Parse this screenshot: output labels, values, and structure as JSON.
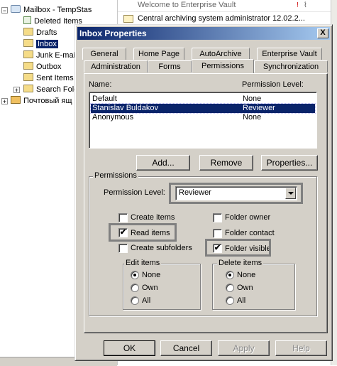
{
  "background": {
    "tree": {
      "mailbox": "Mailbox - TempStas",
      "items": [
        "Deleted Items",
        "Drafts",
        "Inbox",
        "Junk E-mail",
        "Outbox",
        "Sent Items",
        "Search Folders"
      ],
      "selected": "Inbox",
      "other_root": "Почтовый ящ"
    },
    "messages": {
      "row1_subject": "Welcome to Enterprise Vault",
      "row2_sender": "Central archiving system administrator",
      "row2_date": "12.02.2..."
    }
  },
  "dialog": {
    "title": "Inbox Properties",
    "close_label": "X",
    "tabs_row1": [
      "General",
      "Home Page",
      "AutoArchive",
      "Enterprise Vault"
    ],
    "tabs_row2": [
      "Administration",
      "Forms",
      "Permissions",
      "Synchronization"
    ],
    "active_tab": "Permissions",
    "list_headers": {
      "name": "Name:",
      "level": "Permission Level:"
    },
    "permissions_rows": [
      {
        "name": "Default",
        "level": "None",
        "selected": false
      },
      {
        "name": "Stanislav Buldakov",
        "level": "Reviewer",
        "selected": true
      },
      {
        "name": "Anonymous",
        "level": "None",
        "selected": false
      }
    ],
    "list_buttons": {
      "add": "Add...",
      "remove": "Remove",
      "properties": "Properties..."
    },
    "permissions_group": {
      "title": "Permissions",
      "level_label": "Permission Level:",
      "level_value": "Reviewer",
      "checkboxes": {
        "create_items": {
          "label": "Create items",
          "checked": false
        },
        "read_items": {
          "label": "Read items",
          "checked": true
        },
        "create_subfolders": {
          "label": "Create subfolders",
          "checked": false
        },
        "folder_owner": {
          "label": "Folder owner",
          "checked": false
        },
        "folder_contact": {
          "label": "Folder contact",
          "checked": false
        },
        "folder_visible": {
          "label": "Folder visible",
          "checked": true
        }
      },
      "edit_items": {
        "title": "Edit items",
        "options": [
          "None",
          "Own",
          "All"
        ],
        "selected": "None"
      },
      "delete_items": {
        "title": "Delete items",
        "options": [
          "None",
          "Own",
          "All"
        ],
        "selected": "None"
      }
    },
    "footer": {
      "ok": "OK",
      "cancel": "Cancel",
      "apply": "Apply",
      "help": "Help"
    },
    "check_mark": "✔",
    "minus_mark": "−",
    "plus_mark": "+"
  },
  "colors": {
    "titlebar": "#0a246a",
    "selection": "#0a246a",
    "face": "#d4d0c8"
  }
}
